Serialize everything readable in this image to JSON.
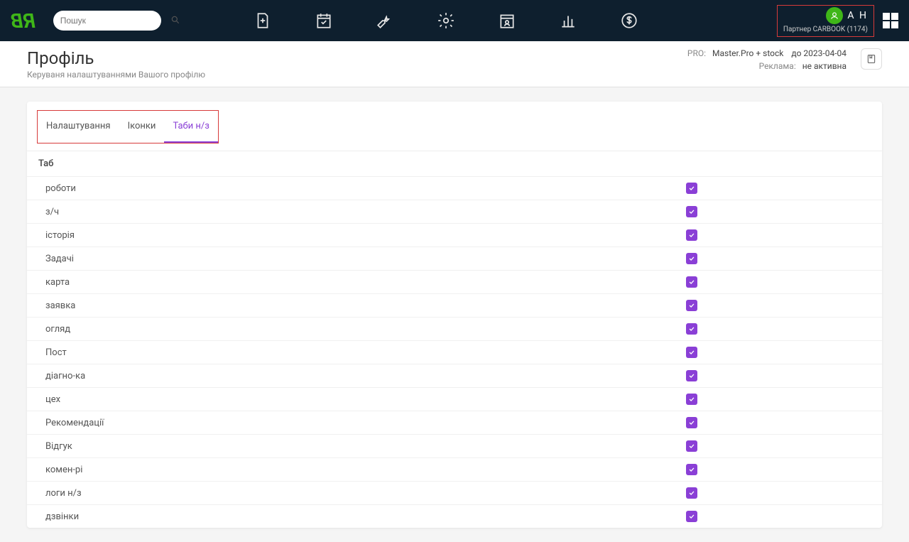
{
  "search": {
    "placeholder": "Пошук"
  },
  "user": {
    "initials": "А Н",
    "sub": "Партнер CARBOOK (1174)"
  },
  "page": {
    "title": "Профіль",
    "subtitle": "Керуваня налаштуваннями Вашого профілю"
  },
  "info": {
    "pro_label": "PRO:",
    "pro_value": "Master.Pro + stock",
    "until": "до 2023-04-04",
    "ad_label": "Реклама:",
    "ad_value": "не активна"
  },
  "tabs": {
    "settings": "Налаштування",
    "icons": "Іконки",
    "tabs_nz": "Таби н/з"
  },
  "table": {
    "header": "Таб",
    "rows": [
      {
        "label": "роботи",
        "checked": true
      },
      {
        "label": "з/ч",
        "checked": true
      },
      {
        "label": "історія",
        "checked": true
      },
      {
        "label": "Задачі",
        "checked": true
      },
      {
        "label": "карта",
        "checked": true
      },
      {
        "label": "заявка",
        "checked": true
      },
      {
        "label": "огляд",
        "checked": true
      },
      {
        "label": "Пост",
        "checked": true
      },
      {
        "label": "діагно-ка",
        "checked": true
      },
      {
        "label": "цех",
        "checked": true
      },
      {
        "label": "Рекомендації",
        "checked": true
      },
      {
        "label": "Відгук",
        "checked": true
      },
      {
        "label": "комен-рі",
        "checked": true
      },
      {
        "label": "логи н/з",
        "checked": true
      },
      {
        "label": "дзвінки",
        "checked": true
      }
    ]
  }
}
